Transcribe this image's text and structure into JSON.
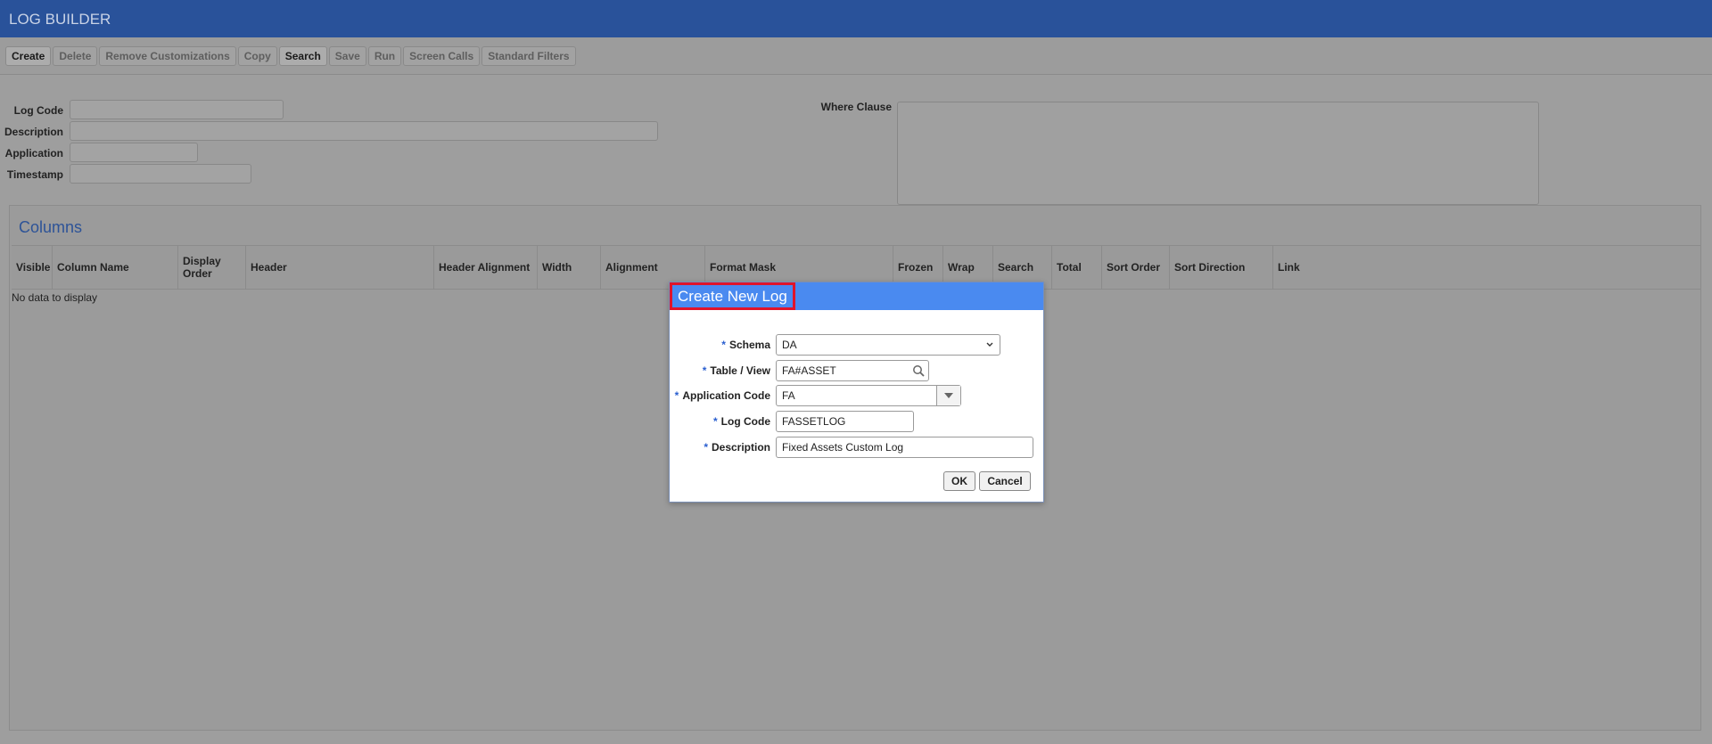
{
  "app": {
    "title": "LOG BUILDER"
  },
  "toolbar": {
    "buttons": [
      {
        "label": "Create",
        "enabled": true
      },
      {
        "label": "Delete",
        "enabled": false
      },
      {
        "label": "Remove Customizations",
        "enabled": false
      },
      {
        "label": "Copy",
        "enabled": false
      },
      {
        "label": "Search",
        "enabled": true
      },
      {
        "label": "Save",
        "enabled": false
      },
      {
        "label": "Run",
        "enabled": false
      },
      {
        "label": "Screen Calls",
        "enabled": false
      },
      {
        "label": "Standard Filters",
        "enabled": false
      }
    ]
  },
  "form": {
    "log_code_label": "Log Code",
    "description_label": "Description",
    "application_label": "Application",
    "timestamp_label": "Timestamp",
    "where_clause_label": "Where Clause"
  },
  "columns": {
    "title": "Columns",
    "headers": [
      "Visible",
      "Column Name",
      "Display Order",
      "Header",
      "Header Alignment",
      "Width",
      "Alignment",
      "Format Mask",
      "Frozen",
      "Wrap",
      "Search",
      "Total",
      "Sort Order",
      "Sort Direction",
      "Link"
    ],
    "empty_text": "No data to display"
  },
  "dialog": {
    "title": "Create New Log",
    "required_marker": "*",
    "schema_label": "Schema",
    "schema_value": "DA",
    "table_view_label": "Table / View",
    "table_view_value": "FA#ASSET",
    "app_code_label": "Application Code",
    "app_code_value": "FA",
    "log_code_label": "Log Code",
    "log_code_value": "FASSETLOG",
    "description_label": "Description",
    "description_value": "Fixed Assets Custom Log",
    "ok_label": "OK",
    "cancel_label": "Cancel"
  },
  "colors": {
    "titlebar": "#29529a",
    "dialog_header": "#4a8af0",
    "highlight_border": "#e0142a",
    "required": "#2a5fd0"
  }
}
